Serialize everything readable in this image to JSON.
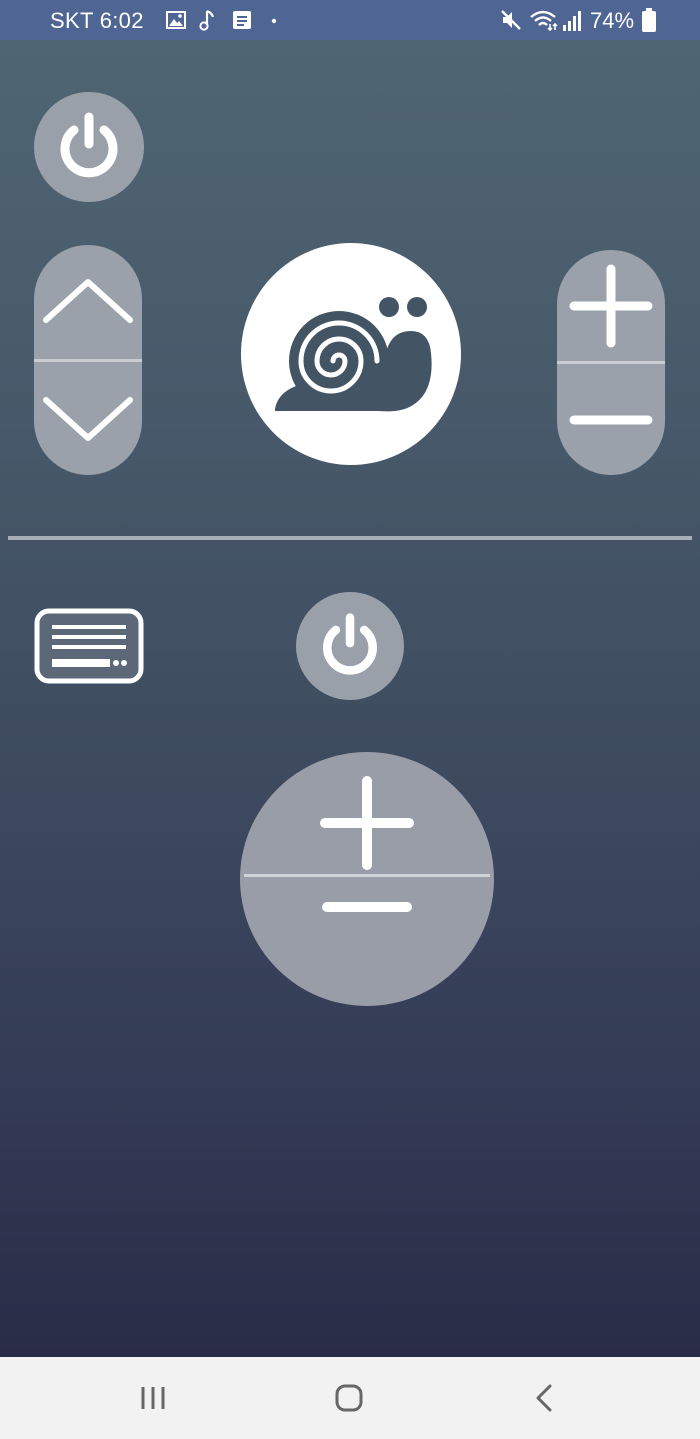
{
  "status_bar": {
    "carrier": "SKT",
    "time": "6:02",
    "battery_percent": "74%",
    "icons": [
      "image-notification-icon",
      "music-note-icon",
      "document-notification-icon",
      "dot-icon",
      "mute-icon",
      "wifi-icon",
      "cellular-signal-icon",
      "battery-icon"
    ]
  },
  "remote": {
    "power_main": "power-icon",
    "channel_rocker": [
      "chevron-up-icon",
      "chevron-down-icon"
    ],
    "slow_mode": "snail-icon",
    "volume_rocker": [
      "plus-icon",
      "minus-icon"
    ],
    "menu": "menu-panel-icon",
    "power_secondary": "power-icon",
    "volume_dial": [
      "plus-icon",
      "minus-icon"
    ]
  },
  "nav_bar": {
    "buttons": [
      "recent-apps-icon",
      "home-icon",
      "back-icon"
    ]
  },
  "colors": {
    "status_bar": "#4f6694",
    "background_top": "#4f6572",
    "background_bottom": "#292c47",
    "button_fill": "#9aa1ab",
    "icon_white": "#ffffff",
    "nav_bar": "#f2f2f2"
  }
}
